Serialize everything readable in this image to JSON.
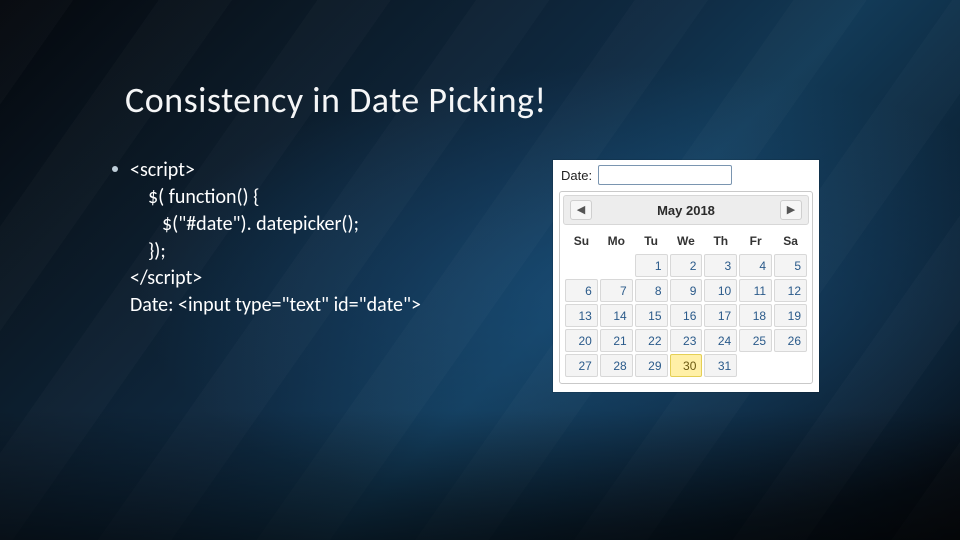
{
  "title": "Consistency in Date Picking!",
  "code": {
    "l1": "<script>",
    "l2": "$( function() {",
    "l3": "$(\"#date\"). datepicker();",
    "l4": "});",
    "l5": "</script>",
    "l6": "Date: <input type=\"text\" id=\"date\">"
  },
  "datepicker": {
    "label": "Date:",
    "input_value": "",
    "month_title": "May 2018",
    "prev_glyph": "◀",
    "next_glyph": "▶",
    "dow": [
      "Su",
      "Mo",
      "Tu",
      "We",
      "Th",
      "Fr",
      "Sa"
    ],
    "rows": [
      [
        {
          "n": "",
          "blank": true
        },
        {
          "n": "",
          "blank": true
        },
        {
          "n": "1"
        },
        {
          "n": "2"
        },
        {
          "n": "3"
        },
        {
          "n": "4"
        },
        {
          "n": "5"
        }
      ],
      [
        {
          "n": "6"
        },
        {
          "n": "7"
        },
        {
          "n": "8"
        },
        {
          "n": "9"
        },
        {
          "n": "10"
        },
        {
          "n": "11"
        },
        {
          "n": "12"
        }
      ],
      [
        {
          "n": "13"
        },
        {
          "n": "14"
        },
        {
          "n": "15"
        },
        {
          "n": "16"
        },
        {
          "n": "17"
        },
        {
          "n": "18"
        },
        {
          "n": "19"
        }
      ],
      [
        {
          "n": "20"
        },
        {
          "n": "21"
        },
        {
          "n": "22"
        },
        {
          "n": "23"
        },
        {
          "n": "24"
        },
        {
          "n": "25"
        },
        {
          "n": "26"
        }
      ],
      [
        {
          "n": "27"
        },
        {
          "n": "28"
        },
        {
          "n": "29"
        },
        {
          "n": "30",
          "hl": true
        },
        {
          "n": "31"
        },
        {
          "n": "",
          "blank": true
        },
        {
          "n": "",
          "blank": true
        }
      ]
    ]
  }
}
